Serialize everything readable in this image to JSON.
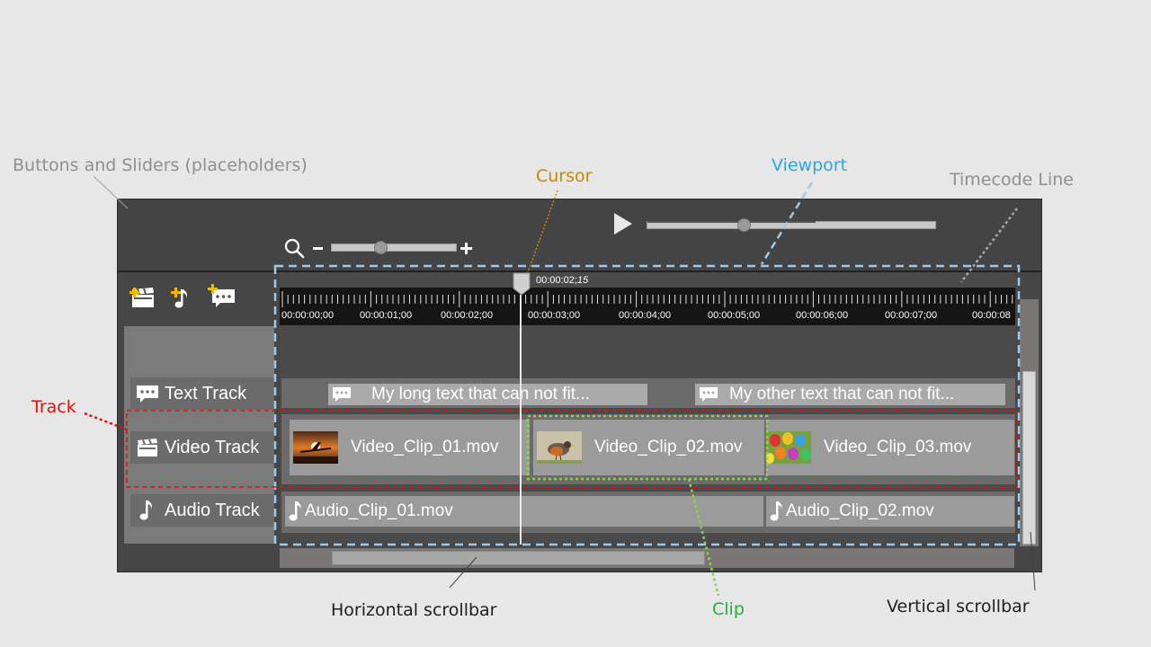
{
  "annotations": {
    "buttons_sliders": "Buttons and Sliders (placeholders)",
    "cursor": "Cursor",
    "viewport": "Viewport",
    "timecode_line": "Timecode Line",
    "track": "Track",
    "clip": "Clip",
    "horizontal_scrollbar": "Horizontal scrollbar",
    "vertical_scrollbar": "Vertical scrollbar"
  },
  "colors": {
    "annotation_gray": "#8f8f8f",
    "cursor": "#c08c00",
    "viewport": "#2aa6e0",
    "track": "#e01010",
    "clip": "#22b03a",
    "accent_add": "#f0b800"
  },
  "toolbar": {
    "play_icon": "play-icon",
    "play_progress": 0.34,
    "zoom_icon": "magnifier-icon",
    "zoom_level": 0.4
  },
  "add_buttons": [
    {
      "icon": "add-video-track-icon"
    },
    {
      "icon": "add-audio-track-icon"
    },
    {
      "icon": "add-text-track-icon"
    }
  ],
  "timecode": {
    "cursor_time": "00:00:02;",
    "cursor_frames": "15",
    "ticks": [
      "00:00:00;00",
      "00:00:01;00",
      "00:00:02;00",
      "00:00:03;00",
      "00:00:04;00",
      "00:00:05;00",
      "00:00:06;00",
      "00:00:07;00",
      "00:00:08"
    ]
  },
  "tracks": {
    "text": {
      "label": "Text Track",
      "icon": "speech-bubble-icon"
    },
    "video": {
      "label": "Video Track",
      "icon": "clapperboard-icon"
    },
    "audio": {
      "label": "Audio Track",
      "icon": "music-note-icon"
    }
  },
  "clips": {
    "text": [
      {
        "label": "My long text that can not fit..."
      },
      {
        "label": "My other text that can not fit..."
      }
    ],
    "video": [
      {
        "label": "Video_Clip_01.mov",
        "thumb": "airplane-sunset-thumbnail"
      },
      {
        "label": "Video_Clip_02.mov",
        "thumb": "robin-bird-thumbnail"
      },
      {
        "label": "Video_Clip_03.mov",
        "thumb": "colorful-eggs-thumbnail"
      }
    ],
    "audio": [
      {
        "label": "Audio_Clip_01.mov"
      },
      {
        "label": "Audio_Clip_02.mov"
      }
    ]
  },
  "scrollbars": {
    "horizontal_position": 0.07,
    "vertical_position": 0.3
  }
}
